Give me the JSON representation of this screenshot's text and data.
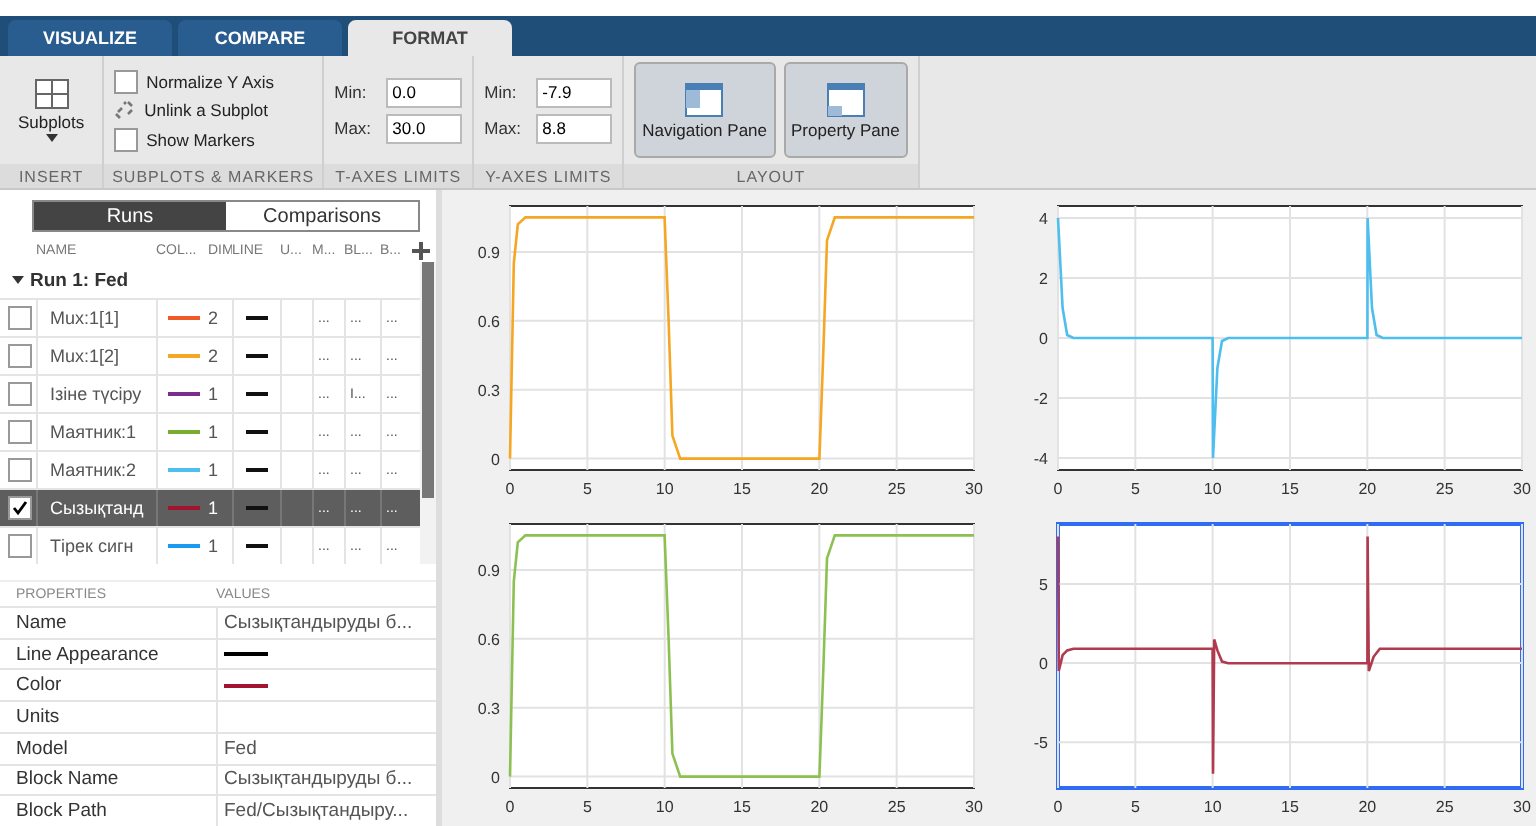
{
  "tabs": [
    {
      "label": "VISUALIZE",
      "selected": false
    },
    {
      "label": "COMPARE",
      "selected": false
    },
    {
      "label": "FORMAT",
      "selected": true
    }
  ],
  "ribbon": {
    "insert": {
      "label": "Subplots",
      "caption": "INSERT"
    },
    "subplots_markers": {
      "caption": "SUBPLOTS & MARKERS",
      "items": [
        {
          "kind": "checkbox",
          "label": "Normalize Y Axis",
          "checked": false
        },
        {
          "kind": "action",
          "label": "Unlink a Subplot"
        },
        {
          "kind": "checkbox",
          "label": "Show Markers",
          "checked": false
        }
      ]
    },
    "t_axes": {
      "caption": "T-AXES LIMITS",
      "fields": [
        {
          "label": "Min:",
          "value": "0.0"
        },
        {
          "label": "Max:",
          "value": "30.0"
        }
      ]
    },
    "y_axes": {
      "caption": "Y-AXES LIMITS",
      "fields": [
        {
          "label": "Min:",
          "value": "-7.9"
        },
        {
          "label": "Max:",
          "value": "8.8"
        }
      ]
    },
    "layout": {
      "caption": "LAYOUT",
      "buttons": [
        {
          "label": "Navigation Pane",
          "selected": true,
          "kind": "nav"
        },
        {
          "label": "Property Pane",
          "selected": true,
          "kind": "prop"
        }
      ]
    }
  },
  "view_toggle": [
    {
      "label": "Runs",
      "selected": true
    },
    {
      "label": "Comparisons",
      "selected": false
    }
  ],
  "signals": {
    "columns": [
      "NAME",
      "COL...",
      "DIM",
      "LINE",
      "U...",
      "M...",
      "BL...",
      "B..."
    ],
    "run": {
      "label": "Run 1: Fed",
      "expanded": true
    },
    "rows": [
      {
        "name": "Mux:1[1]",
        "checked": false,
        "selected": false,
        "color": "#f05a28",
        "dim": "2",
        "col_5": "",
        "col_6": "...",
        "col_7": "...",
        "col_8": "..."
      },
      {
        "name": "Mux:1[2]",
        "checked": false,
        "selected": false,
        "color": "#f5a623",
        "dim": "2",
        "col_5": "",
        "col_6": "...",
        "col_7": "...",
        "col_8": "..."
      },
      {
        "name": "Ізіне түсіру",
        "checked": false,
        "selected": false,
        "color": "#7b2d8e",
        "dim": "1",
        "col_5": "",
        "col_6": "...",
        "col_7": "I...",
        "col_8": "..."
      },
      {
        "name": "Маятник:1",
        "checked": false,
        "selected": false,
        "color": "#77ac30",
        "dim": "1",
        "col_5": "",
        "col_6": "...",
        "col_7": "...",
        "col_8": "..."
      },
      {
        "name": "Маятник:2",
        "checked": false,
        "selected": false,
        "color": "#4dbeee",
        "dim": "1",
        "col_5": "",
        "col_6": "...",
        "col_7": "...",
        "col_8": "..."
      },
      {
        "name": "Сызықтанд",
        "checked": true,
        "selected": true,
        "color": "#a2142f",
        "dim": "1",
        "col_5": "",
        "col_6": "...",
        "col_7": "...",
        "col_8": "..."
      },
      {
        "name": "Тірек сигн",
        "checked": false,
        "selected": false,
        "color": "#1a9bf0",
        "dim": "1",
        "col_5": "",
        "col_6": "...",
        "col_7": "...",
        "col_8": "..."
      }
    ]
  },
  "properties": {
    "columns": [
      "PROPERTIES",
      "VALUES"
    ],
    "rows": [
      {
        "name": "Name",
        "kind": "text",
        "value": "Сызықтандыруды б..."
      },
      {
        "name": "Line Appearance",
        "kind": "line",
        "color": "#000000"
      },
      {
        "name": "Color",
        "kind": "line",
        "color": "#a2142f"
      },
      {
        "name": "Units",
        "kind": "text"
      },
      {
        "name": "Model",
        "kind": "text",
        "value": "Fed"
      },
      {
        "name": "Block Name",
        "kind": "text",
        "value": "Сызықтандыруды б..."
      },
      {
        "name": "Block Path",
        "kind": "text",
        "value": "Fed/Сызықтандыру..."
      }
    ]
  },
  "plots": [
    {
      "selected": false,
      "chart_data": {
        "type": "line",
        "x": [
          0,
          0.25,
          0.5,
          1,
          10,
          10.25,
          10.5,
          11,
          20,
          20.25,
          20.5,
          21,
          30
        ],
        "grid": true,
        "series": [
          {
            "color": "#f5a623",
            "values": [
              0,
              0.85,
              1.02,
              1.05,
              1.05,
              0.6,
              0.1,
              0,
              0,
              0.45,
              0.95,
              1.05,
              1.05
            ]
          }
        ],
        "xlim": [
          0,
          30
        ],
        "ylim": [
          -0.05,
          1.1
        ],
        "xticks": [
          0,
          5,
          10,
          15,
          20,
          25,
          30
        ],
        "yticks": [
          0,
          0.3,
          0.6,
          0.9
        ]
      }
    },
    {
      "selected": false,
      "chart_data": {
        "type": "line",
        "x": [
          0,
          0.3,
          0.6,
          1,
          10,
          10.02,
          10.3,
          10.6,
          11,
          20,
          20.02,
          20.3,
          20.6,
          21,
          30
        ],
        "grid": true,
        "series": [
          {
            "color": "#4dbeee",
            "values": [
              4,
              1,
              0.1,
              0,
              0,
              -4,
              -1,
              -0.1,
              0,
              0,
              4,
              1,
              0.1,
              0,
              0
            ]
          }
        ],
        "xlim": [
          0,
          30
        ],
        "ylim": [
          -4.4,
          4.4
        ],
        "xticks": [
          0,
          5,
          10,
          15,
          20,
          25,
          30
        ],
        "yticks": [
          -4,
          -2,
          0,
          2,
          4
        ]
      }
    },
    {
      "selected": false,
      "chart_data": {
        "type": "line",
        "x": [
          0,
          0.25,
          0.5,
          1,
          10,
          10.25,
          10.5,
          11,
          20,
          20.25,
          20.5,
          21,
          30
        ],
        "grid": true,
        "series": [
          {
            "color": "#8cc152",
            "values": [
              0,
              0.85,
              1.02,
              1.05,
              1.05,
              0.6,
              0.1,
              0,
              0,
              0.45,
              0.95,
              1.05,
              1.05
            ]
          }
        ],
        "xlim": [
          0,
          30
        ],
        "ylim": [
          -0.05,
          1.1
        ],
        "xticks": [
          0,
          5,
          10,
          15,
          20,
          25,
          30
        ],
        "yticks": [
          0,
          0.3,
          0.6,
          0.9
        ]
      }
    },
    {
      "selected": true,
      "chart_data": {
        "type": "line",
        "x": [
          0,
          0.05,
          0.3,
          0.6,
          1,
          10,
          10.02,
          10.1,
          10.3,
          10.6,
          11,
          20,
          20.02,
          20.1,
          20.4,
          20.8,
          30
        ],
        "grid": true,
        "series": [
          {
            "color": "#b03a4e",
            "values": [
              8,
              -0.5,
              0.5,
              0.8,
              0.9,
              0.9,
              -7,
              1.5,
              0.8,
              0.1,
              0,
              0,
              8,
              -0.5,
              0.4,
              0.9,
              0.9
            ]
          }
        ],
        "xlim": [
          0,
          30
        ],
        "ylim": [
          -7.9,
          8.8
        ],
        "xticks": [
          0,
          5,
          10,
          15,
          20,
          25,
          30
        ],
        "yticks": [
          -5,
          0,
          5
        ]
      }
    }
  ]
}
